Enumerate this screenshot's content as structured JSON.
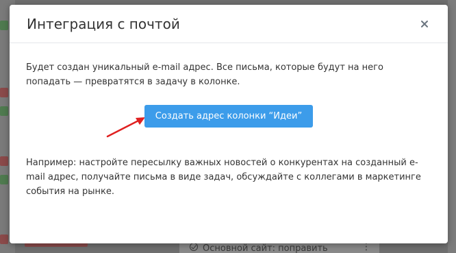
{
  "modal": {
    "title": "Интеграция с почтой",
    "close_icon": "close-icon",
    "description": "Будет создан уникальный e-mail адрес. Все письма, которые будут на него попадать — превратятся в задачу в колонке.",
    "create_button_label": "Создать адрес колонки “Идеи”",
    "example": "Например: настройте пересылку важных новостей о конкурентах на созданный e-mail адрес, получайте письма в виде задач, обсуждайте с коллегами в маркетинге события на рынке.",
    "accent_color": "#3c9cea",
    "annotation_arrow_color": "#e02020"
  },
  "background": {
    "visible_card_text": "Основной сайт: поправить"
  }
}
